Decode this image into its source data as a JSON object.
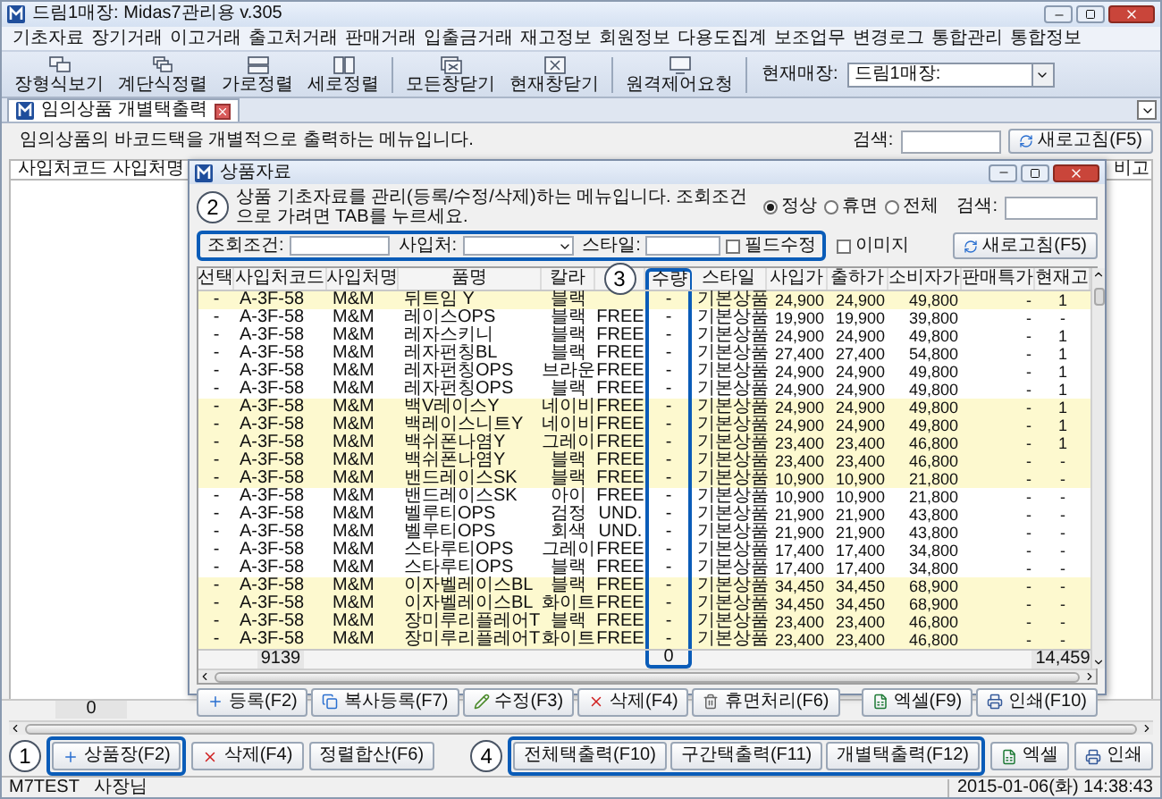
{
  "window": {
    "title": "드림1매장: Midas7관리용 v.305"
  },
  "menu": [
    "기초자료",
    "장기거래",
    "이고거래",
    "출고처거래",
    "판매거래",
    "입출금거래",
    "재고정보",
    "회원정보",
    "다용도집계",
    "보조업무",
    "변경로그",
    "통합관리",
    "통합정보"
  ],
  "toolbar": [
    "장형식보기",
    "계단식정렬",
    "가로정렬",
    "세로정렬",
    "모든창닫기",
    "현재창닫기",
    "원격제어요청"
  ],
  "store": {
    "label": "현재매장:",
    "value": "드림1매장:"
  },
  "tabs": [
    {
      "label": "임의상품 개별택출력",
      "selected": true
    }
  ],
  "panel": {
    "description": "임의상품의 바코드택을 개별적으로 출력하는 메뉴입니다.",
    "search_label": "검색:",
    "refresh": "새로고침(F5)",
    "columns": [
      "사입처코드",
      "사입처명",
      "비고"
    ],
    "footer": "0",
    "buttons_left": [
      "상품장(F2)",
      "삭제(F4)",
      "정렬합산(F6)"
    ],
    "print_buttons": [
      "전체택출력(F10)",
      "구간택출력(F11)",
      "개별택출력(F12)"
    ],
    "buttons_right": [
      "엑셀",
      "인쇄"
    ]
  },
  "dialog": {
    "title": "상품자료",
    "description": "상품 기초자료를 관리(등록/수정/삭제)하는 메뉴입니다. 조회조건으로 가려면 TAB를 누르세요.",
    "radios": [
      {
        "label": "정상",
        "selected": true
      },
      {
        "label": "휴면",
        "selected": false
      },
      {
        "label": "전체",
        "selected": false
      }
    ],
    "search_label": "검색:",
    "filter": {
      "condition_label": "조회조건:",
      "vendor_label": "사입처:",
      "style_label": "스타일:",
      "refresh": "새로고침(F5)"
    },
    "checkboxes": [
      {
        "label": "필드수정",
        "checked": false
      },
      {
        "label": "이미지",
        "checked": false
      }
    ],
    "table": {
      "columns": [
        {
          "label": "선택"
        },
        {
          "label": "사입처코드"
        },
        {
          "label": "사입처명"
        },
        {
          "label": "품명"
        },
        {
          "label": "칼라"
        },
        {
          "kind": "covered"
        },
        {
          "label": "수량"
        },
        {
          "label": "스타일"
        },
        {
          "label": "사입가"
        },
        {
          "label": "출하가"
        },
        {
          "label": "소비자가"
        },
        {
          "label": "판매특가"
        },
        {
          "label": "현재고"
        }
      ],
      "rows": [
        {
          "highlighted": true,
          "cells": [
            "-",
            "A-3F-58",
            "M&M",
            "뒤트임 Y",
            "블랙",
            null,
            "-",
            "기본상품",
            "24,900",
            "24,900",
            "49,800",
            "-",
            "1"
          ]
        },
        {
          "highlighted": false,
          "cells": [
            "-",
            "A-3F-58",
            "M&M",
            "레이스OPS",
            "블랙",
            "FREE",
            "-",
            "기본상품",
            "19,900",
            "19,900",
            "39,800",
            "-",
            "-"
          ]
        },
        {
          "highlighted": false,
          "cells": [
            "-",
            "A-3F-58",
            "M&M",
            "레자스키니",
            "블랙",
            "FREE",
            "-",
            "기본상품",
            "24,900",
            "24,900",
            "49,800",
            "-",
            "1"
          ]
        },
        {
          "highlighted": false,
          "cells": [
            "-",
            "A-3F-58",
            "M&M",
            "레자펀칭BL",
            "블랙",
            "FREE",
            "-",
            "기본상품",
            "27,400",
            "27,400",
            "54,800",
            "-",
            "1"
          ]
        },
        {
          "highlighted": false,
          "cells": [
            "-",
            "A-3F-58",
            "M&M",
            "레자펀칭OPS",
            "브라운",
            "FREE",
            "-",
            "기본상품",
            "24,900",
            "24,900",
            "49,800",
            "-",
            "1"
          ]
        },
        {
          "highlighted": false,
          "cells": [
            "-",
            "A-3F-58",
            "M&M",
            "레자펀칭OPS",
            "블랙",
            "FREE",
            "-",
            "기본상품",
            "24,900",
            "24,900",
            "49,800",
            "-",
            "1"
          ]
        },
        {
          "highlighted": true,
          "cells": [
            "-",
            "A-3F-58",
            "M&M",
            "백V레이스Y",
            "네이비",
            "FREE",
            "-",
            "기본상품",
            "24,900",
            "24,900",
            "49,800",
            "-",
            "1"
          ]
        },
        {
          "highlighted": true,
          "cells": [
            "-",
            "A-3F-58",
            "M&M",
            "백레이스니트Y",
            "네이비",
            "FREE",
            "-",
            "기본상품",
            "24,900",
            "24,900",
            "49,800",
            "-",
            "1"
          ]
        },
        {
          "highlighted": true,
          "cells": [
            "-",
            "A-3F-58",
            "M&M",
            "백쉬폰나염Y",
            "그레이",
            "FREE",
            "-",
            "기본상품",
            "23,400",
            "23,400",
            "46,800",
            "-",
            "1"
          ]
        },
        {
          "highlighted": true,
          "cells": [
            "-",
            "A-3F-58",
            "M&M",
            "백쉬폰나염Y",
            "블랙",
            "FREE",
            "-",
            "기본상품",
            "23,400",
            "23,400",
            "46,800",
            "-",
            "-"
          ]
        },
        {
          "highlighted": true,
          "cells": [
            "-",
            "A-3F-58",
            "M&M",
            "밴드레이스SK",
            "블랙",
            "FREE",
            "-",
            "기본상품",
            "10,900",
            "10,900",
            "21,800",
            "-",
            "-"
          ]
        },
        {
          "highlighted": false,
          "cells": [
            "-",
            "A-3F-58",
            "M&M",
            "밴드레이스SK",
            "아이",
            "FREE",
            "-",
            "기본상품",
            "10,900",
            "10,900",
            "21,800",
            "-",
            "-"
          ]
        },
        {
          "highlighted": false,
          "cells": [
            "-",
            "A-3F-58",
            "M&M",
            "벨루티OPS",
            "검정",
            "UND.",
            "-",
            "기본상품",
            "21,900",
            "21,900",
            "43,800",
            "-",
            "-"
          ]
        },
        {
          "highlighted": false,
          "cells": [
            "-",
            "A-3F-58",
            "M&M",
            "벨루티OPS",
            "회색",
            "UND.",
            "-",
            "기본상품",
            "21,900",
            "21,900",
            "43,800",
            "-",
            "-"
          ]
        },
        {
          "highlighted": false,
          "cells": [
            "-",
            "A-3F-58",
            "M&M",
            "스타루티OPS",
            "그레이",
            "FREE",
            "-",
            "기본상품",
            "17,400",
            "17,400",
            "34,800",
            "-",
            "-"
          ]
        },
        {
          "highlighted": false,
          "cells": [
            "-",
            "A-3F-58",
            "M&M",
            "스타루티OPS",
            "블랙",
            "FREE",
            "-",
            "기본상품",
            "17,400",
            "17,400",
            "34,800",
            "-",
            "-"
          ]
        },
        {
          "highlighted": true,
          "cells": [
            "-",
            "A-3F-58",
            "M&M",
            "이자벨레이스BL",
            "블랙",
            "FREE",
            "-",
            "기본상품",
            "34,450",
            "34,450",
            "68,900",
            "-",
            "-"
          ]
        },
        {
          "highlighted": true,
          "cells": [
            "-",
            "A-3F-58",
            "M&M",
            "이자벨레이스BL",
            "화이트",
            "FREE",
            "-",
            "기본상품",
            "34,450",
            "34,450",
            "68,900",
            "-",
            "-"
          ]
        },
        {
          "highlighted": true,
          "cells": [
            "-",
            "A-3F-58",
            "M&M",
            "장미루리플레어T",
            "블랙",
            "FREE",
            "-",
            "기본상품",
            "23,400",
            "23,400",
            "46,800",
            "-",
            "-"
          ]
        },
        {
          "highlighted": true,
          "cells": [
            "-",
            "A-3F-58",
            "M&M",
            "장미루리플레어T",
            "화이트",
            "FREE",
            "-",
            "기본상품",
            "23,400",
            "23,400",
            "46,800",
            "-",
            "-"
          ]
        }
      ],
      "footer": {
        "code_total": "9139",
        "qty_total": "0",
        "stock_total": "14,459"
      }
    },
    "buttons_left": [
      "등록(F2)",
      "복사등록(F7)",
      "수정(F3)",
      "삭제(F4)",
      "휴면처리(F6)"
    ],
    "buttons_right": [
      "엑셀(F9)",
      "인쇄(F10)"
    ]
  },
  "callouts": [
    "1",
    "2",
    "3",
    "4"
  ],
  "status_bar": {
    "user": "M7TEST",
    "role": "사장님",
    "datetime": "2015-01-06(화) 14:38:43"
  }
}
